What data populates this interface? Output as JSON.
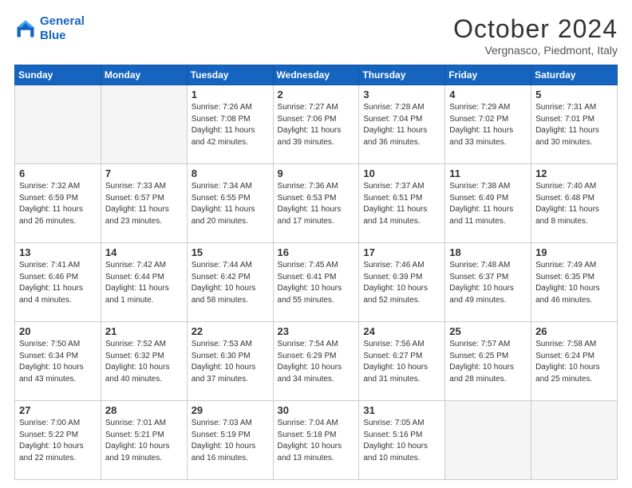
{
  "logo": {
    "line1": "General",
    "line2": "Blue"
  },
  "title": "October 2024",
  "location": "Vergnasco, Piedmont, Italy",
  "days_header": [
    "Sunday",
    "Monday",
    "Tuesday",
    "Wednesday",
    "Thursday",
    "Friday",
    "Saturday"
  ],
  "weeks": [
    [
      {
        "day": "",
        "info": ""
      },
      {
        "day": "",
        "info": ""
      },
      {
        "day": "1",
        "info": "Sunrise: 7:26 AM\nSunset: 7:08 PM\nDaylight: 11 hours\nand 42 minutes."
      },
      {
        "day": "2",
        "info": "Sunrise: 7:27 AM\nSunset: 7:06 PM\nDaylight: 11 hours\nand 39 minutes."
      },
      {
        "day": "3",
        "info": "Sunrise: 7:28 AM\nSunset: 7:04 PM\nDaylight: 11 hours\nand 36 minutes."
      },
      {
        "day": "4",
        "info": "Sunrise: 7:29 AM\nSunset: 7:02 PM\nDaylight: 11 hours\nand 33 minutes."
      },
      {
        "day": "5",
        "info": "Sunrise: 7:31 AM\nSunset: 7:01 PM\nDaylight: 11 hours\nand 30 minutes."
      }
    ],
    [
      {
        "day": "6",
        "info": "Sunrise: 7:32 AM\nSunset: 6:59 PM\nDaylight: 11 hours\nand 26 minutes."
      },
      {
        "day": "7",
        "info": "Sunrise: 7:33 AM\nSunset: 6:57 PM\nDaylight: 11 hours\nand 23 minutes."
      },
      {
        "day": "8",
        "info": "Sunrise: 7:34 AM\nSunset: 6:55 PM\nDaylight: 11 hours\nand 20 minutes."
      },
      {
        "day": "9",
        "info": "Sunrise: 7:36 AM\nSunset: 6:53 PM\nDaylight: 11 hours\nand 17 minutes."
      },
      {
        "day": "10",
        "info": "Sunrise: 7:37 AM\nSunset: 6:51 PM\nDaylight: 11 hours\nand 14 minutes."
      },
      {
        "day": "11",
        "info": "Sunrise: 7:38 AM\nSunset: 6:49 PM\nDaylight: 11 hours\nand 11 minutes."
      },
      {
        "day": "12",
        "info": "Sunrise: 7:40 AM\nSunset: 6:48 PM\nDaylight: 11 hours\nand 8 minutes."
      }
    ],
    [
      {
        "day": "13",
        "info": "Sunrise: 7:41 AM\nSunset: 6:46 PM\nDaylight: 11 hours\nand 4 minutes."
      },
      {
        "day": "14",
        "info": "Sunrise: 7:42 AM\nSunset: 6:44 PM\nDaylight: 11 hours\nand 1 minute."
      },
      {
        "day": "15",
        "info": "Sunrise: 7:44 AM\nSunset: 6:42 PM\nDaylight: 10 hours\nand 58 minutes."
      },
      {
        "day": "16",
        "info": "Sunrise: 7:45 AM\nSunset: 6:41 PM\nDaylight: 10 hours\nand 55 minutes."
      },
      {
        "day": "17",
        "info": "Sunrise: 7:46 AM\nSunset: 6:39 PM\nDaylight: 10 hours\nand 52 minutes."
      },
      {
        "day": "18",
        "info": "Sunrise: 7:48 AM\nSunset: 6:37 PM\nDaylight: 10 hours\nand 49 minutes."
      },
      {
        "day": "19",
        "info": "Sunrise: 7:49 AM\nSunset: 6:35 PM\nDaylight: 10 hours\nand 46 minutes."
      }
    ],
    [
      {
        "day": "20",
        "info": "Sunrise: 7:50 AM\nSunset: 6:34 PM\nDaylight: 10 hours\nand 43 minutes."
      },
      {
        "day": "21",
        "info": "Sunrise: 7:52 AM\nSunset: 6:32 PM\nDaylight: 10 hours\nand 40 minutes."
      },
      {
        "day": "22",
        "info": "Sunrise: 7:53 AM\nSunset: 6:30 PM\nDaylight: 10 hours\nand 37 minutes."
      },
      {
        "day": "23",
        "info": "Sunrise: 7:54 AM\nSunset: 6:29 PM\nDaylight: 10 hours\nand 34 minutes."
      },
      {
        "day": "24",
        "info": "Sunrise: 7:56 AM\nSunset: 6:27 PM\nDaylight: 10 hours\nand 31 minutes."
      },
      {
        "day": "25",
        "info": "Sunrise: 7:57 AM\nSunset: 6:25 PM\nDaylight: 10 hours\nand 28 minutes."
      },
      {
        "day": "26",
        "info": "Sunrise: 7:58 AM\nSunset: 6:24 PM\nDaylight: 10 hours\nand 25 minutes."
      }
    ],
    [
      {
        "day": "27",
        "info": "Sunrise: 7:00 AM\nSunset: 5:22 PM\nDaylight: 10 hours\nand 22 minutes."
      },
      {
        "day": "28",
        "info": "Sunrise: 7:01 AM\nSunset: 5:21 PM\nDaylight: 10 hours\nand 19 minutes."
      },
      {
        "day": "29",
        "info": "Sunrise: 7:03 AM\nSunset: 5:19 PM\nDaylight: 10 hours\nand 16 minutes."
      },
      {
        "day": "30",
        "info": "Sunrise: 7:04 AM\nSunset: 5:18 PM\nDaylight: 10 hours\nand 13 minutes."
      },
      {
        "day": "31",
        "info": "Sunrise: 7:05 AM\nSunset: 5:16 PM\nDaylight: 10 hours\nand 10 minutes."
      },
      {
        "day": "",
        "info": ""
      },
      {
        "day": "",
        "info": ""
      }
    ]
  ]
}
